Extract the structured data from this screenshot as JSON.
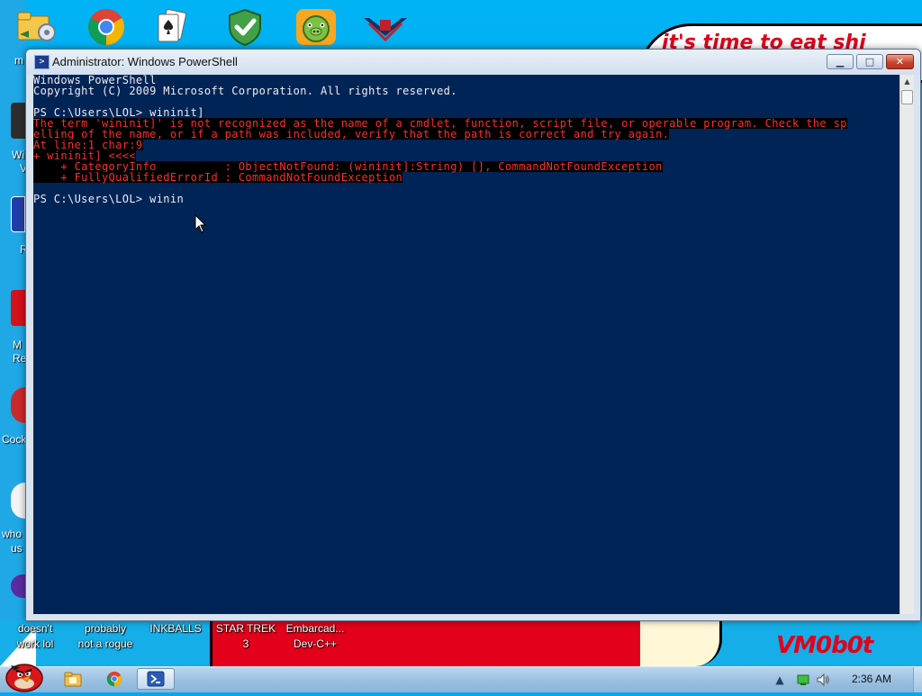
{
  "window": {
    "title": "Administrator: Windows PowerShell",
    "icon_name": "powershell-icon",
    "controls": {
      "minimize": "minimize-icon",
      "maximize": "maximize-icon",
      "close": "close-icon"
    }
  },
  "console": {
    "background": "#012456",
    "foreground": "#eeedf0",
    "error_color": "#ff2b2b",
    "lines": [
      {
        "text": "Windows PowerShell",
        "type": "normal"
      },
      {
        "text": "Copyright (C) 2009 Microsoft Corporation. All rights reserved.",
        "type": "normal"
      },
      {
        "text": "",
        "type": "blank"
      },
      {
        "text": "PS C:\\Users\\LOL> wininit]",
        "type": "normal"
      },
      {
        "text": "The term 'wininit]' is not recognized as the name of a cmdlet, function, script file, or operable program. Check the sp",
        "type": "error"
      },
      {
        "text": "elling of the name, or if a path was included, verify that the path is correct and try again.",
        "type": "error"
      },
      {
        "text": "At line:1 char:9",
        "type": "error"
      },
      {
        "text": "+ wininit] <<<<",
        "type": "error"
      },
      {
        "text": "    + CategoryInfo          : ObjectNotFound: (wininit]:String) [], CommandNotFoundException",
        "type": "error"
      },
      {
        "text": "    + FullyQualifiedErrorId : CommandNotFoundException",
        "type": "error"
      },
      {
        "text": "",
        "type": "blank"
      },
      {
        "text": "PS C:\\Users\\LOL> winin",
        "type": "normal"
      }
    ]
  },
  "desktop": {
    "wallpaper_text": "it's time to eat shi",
    "wallpaper_signature": "VM0b0t",
    "top_icons": [
      {
        "icon": "folder-gear-icon"
      },
      {
        "icon": "chrome-icon"
      },
      {
        "icon": "solitaire-icon"
      },
      {
        "icon": "security-shield-icon"
      },
      {
        "icon": "bad-piggies-icon"
      },
      {
        "icon": "vmobot-logo-icon"
      }
    ],
    "left_labels": {
      "m": "m",
      "wi": "Wi",
      "v": "V",
      "r": "R",
      "mr1": "M",
      "mr2": "Re",
      "cock": "Cock",
      "who1": "who",
      "who2": "us"
    },
    "bottom_icons": [
      {
        "line1": "doesn't",
        "line2": "work lol"
      },
      {
        "line1": "probably",
        "line2": "not a rogue"
      },
      {
        "line1": "INKBALLS",
        "line2": ""
      },
      {
        "line1": "STAR TREK",
        "line2": "3"
      },
      {
        "line1": "Embarcad...",
        "line2": "Dev-C++"
      }
    ]
  },
  "taskbar": {
    "start_icon": "angry-bird-start-icon",
    "items": [
      {
        "icon": "explorer-folder-icon",
        "active": false
      },
      {
        "icon": "chrome-icon",
        "active": false
      },
      {
        "icon": "powershell-icon",
        "active": true
      }
    ],
    "tray": {
      "icons": [
        "show-hidden-icons-arrow-icon",
        "network-icon",
        "volume-icon"
      ],
      "clock": "2:36 AM"
    }
  }
}
